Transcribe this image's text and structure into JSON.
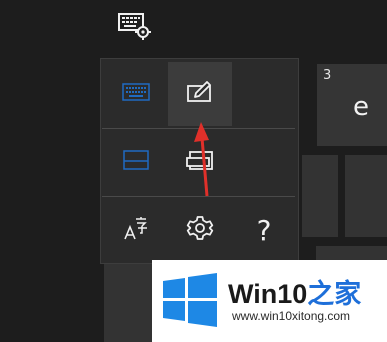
{
  "top": {
    "icon": "keyboard-settings-icon"
  },
  "background_keys": {
    "e_key": {
      "number": "3",
      "char": "e"
    }
  },
  "flyout": {
    "rows": [
      [
        {
          "icon": "keyboard-layout-icon",
          "selected": false
        },
        {
          "icon": "handwriting-pen-icon",
          "selected": true
        }
      ],
      [
        {
          "icon": "docked-keyboard-icon",
          "selected": false
        },
        {
          "icon": "undocked-keyboard-icon",
          "selected": false
        }
      ],
      [
        {
          "icon": "language-icon",
          "selected": false
        },
        {
          "icon": "gear-icon",
          "selected": false
        },
        {
          "icon": "help-icon",
          "label": "?",
          "selected": false
        }
      ]
    ]
  },
  "colors": {
    "accent": "#1f6bc1",
    "arrow": "#e0302a",
    "flyout_bg": "#2b2b2b",
    "selected_bg": "#3c3c3c"
  },
  "watermark": {
    "title_part1": "Win10",
    "title_part2": "之家",
    "url": "www.win10xitong.com"
  }
}
